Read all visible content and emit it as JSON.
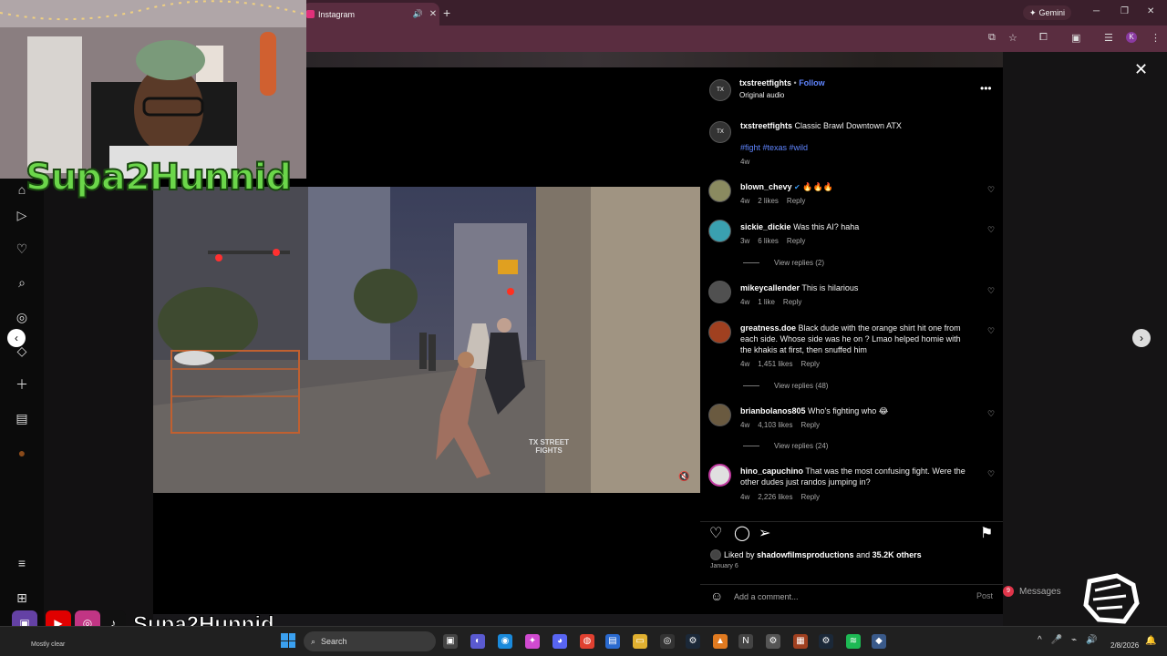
{
  "browser": {
    "tab_title": "Instagram",
    "gemini_label": "Gemini",
    "profile_initial": "K"
  },
  "stream": {
    "name_overlay": "Supa2Hunnid",
    "bottom_handle": "Supa2Hunnid"
  },
  "post": {
    "username": "txstreetfights",
    "follow_label": "Follow",
    "audio": "Original audio",
    "caption_user": "txstreetfights",
    "caption_text": "Classic Brawl Downtown ATX",
    "caption_tags": "#fight #texas #wild",
    "caption_age": "4w",
    "liked_by_prefix": "Liked by",
    "liked_by_user": "shadowfilmsproductions",
    "liked_by_and": "and",
    "liked_by_others": "35.2K others",
    "date": "January 6",
    "add_comment_placeholder": "Add a comment...",
    "post_label": "Post",
    "watermark_line1": "TX STREET",
    "watermark_line2": "FIGHTS"
  },
  "comments": [
    {
      "user": "blown_chevy",
      "text": "🔥🔥🔥",
      "age": "4w",
      "likes": "2 likes",
      "reply": "Reply",
      "verified": true
    },
    {
      "user": "sickie_dickie",
      "text": "Was this AI? haha",
      "age": "3w",
      "likes": "6 likes",
      "reply": "Reply",
      "view_replies": "View replies (2)"
    },
    {
      "user": "mikeycallender",
      "text": "This is hilarious",
      "age": "4w",
      "likes": "1 like",
      "reply": "Reply"
    },
    {
      "user": "greatness.doe",
      "text": "Black dude with the orange shirt hit one from each side. Whose side was he on ? Lmao helped homie with the khakis at first, then snuffed him",
      "age": "4w",
      "likes": "1,451 likes",
      "reply": "Reply",
      "view_replies": "View replies (48)"
    },
    {
      "user": "brianbolanos805",
      "text": "Who's fighting who 😂",
      "age": "4w",
      "likes": "4,103 likes",
      "reply": "Reply",
      "view_replies": "View replies (24)"
    },
    {
      "user": "hino_capuchino",
      "text": "That was the most confusing fight. Were the other dudes just randos jumping in?",
      "age": "4w",
      "likes": "2,226 likes",
      "reply": "Reply"
    }
  ],
  "messages": {
    "label": "Messages",
    "badge": "9"
  },
  "taskbar": {
    "weather": "Mostly clear",
    "search_label": "Search",
    "date": "2/8/2026"
  },
  "icons": {
    "close": "close-icon",
    "more": "more-options-icon",
    "heart": "heart-icon",
    "comment": "comment-icon",
    "share": "share-icon",
    "save": "bookmark-icon",
    "emoji": "emoji-icon"
  },
  "colors": {
    "instagram_link": "#5f85ff",
    "panel_bg": "#000000",
    "browser_tab_bg": "#5a2d40",
    "streamer_green": "#6bd64a"
  }
}
